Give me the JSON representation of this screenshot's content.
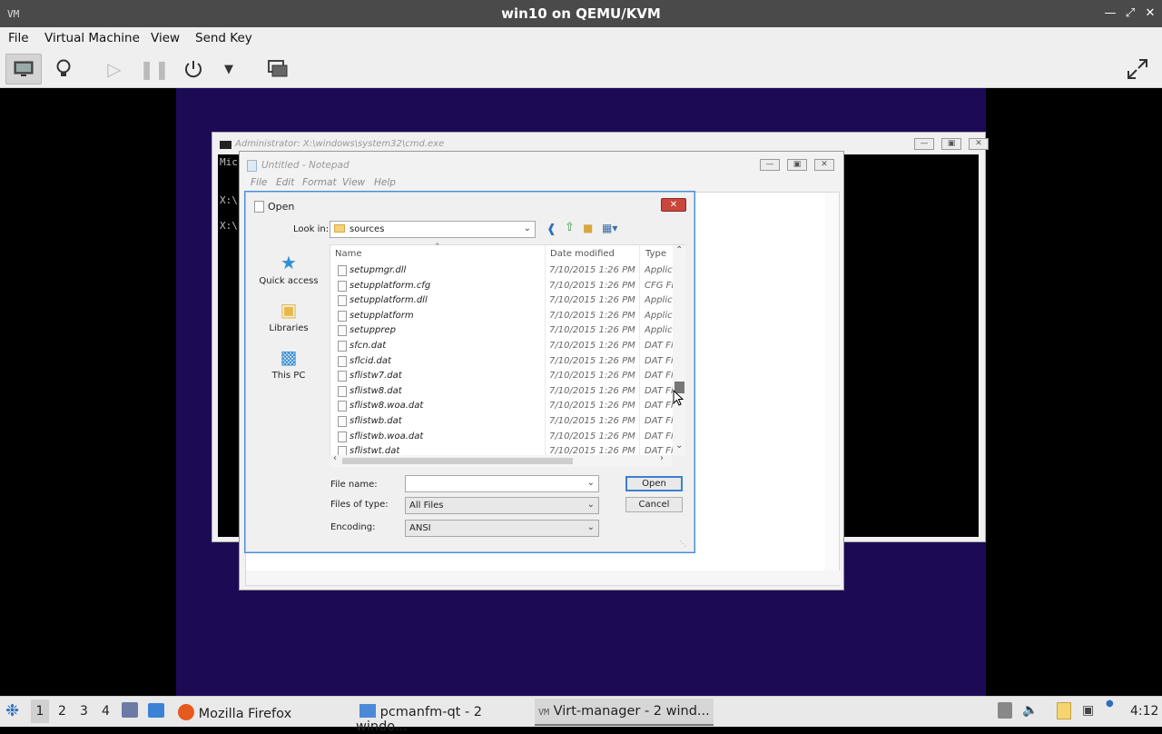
{
  "window": {
    "title": "win10 on QEMU/KVM",
    "app_icon": "VM"
  },
  "menubar": {
    "items": [
      "File",
      "Virtual Machine",
      "View",
      "Send Key"
    ]
  },
  "toolbar": {
    "buttons": [
      "console-icon",
      "details-lightbulb-icon",
      "run-icon",
      "pause-icon",
      "power-icon",
      "power-menu-arrow-icon",
      "snapshots-icon",
      "fullscreen-icon"
    ]
  },
  "guest": {
    "cmd": {
      "title": "Administrator: X:\\windows\\system32\\cmd.exe",
      "lines": [
        "Mic",
        "X:\\",
        "X:\\"
      ]
    },
    "notepad": {
      "title": "Untitled - Notepad",
      "menu": [
        "File",
        "Edit",
        "Format",
        "View",
        "Help"
      ]
    },
    "open_dialog": {
      "title": "Open",
      "look_in_label": "Look in:",
      "look_in_value": "sources",
      "nav": [
        "Quick access",
        "Libraries",
        "This PC"
      ],
      "columns": {
        "name": "Name",
        "date": "Date modified",
        "type": "Type"
      },
      "files": [
        {
          "name": "setupmgr.dll",
          "date": "7/10/2015 1:26 PM",
          "type": "Applicati"
        },
        {
          "name": "setupplatform.cfg",
          "date": "7/10/2015 1:26 PM",
          "type": "CFG File"
        },
        {
          "name": "setupplatform.dll",
          "date": "7/10/2015 1:26 PM",
          "type": "Applicati"
        },
        {
          "name": "setupplatform",
          "date": "7/10/2015 1:26 PM",
          "type": "Applicati"
        },
        {
          "name": "setupprep",
          "date": "7/10/2015 1:26 PM",
          "type": "Applicati"
        },
        {
          "name": "sfcn.dat",
          "date": "7/10/2015 1:26 PM",
          "type": "DAT File"
        },
        {
          "name": "sflcid.dat",
          "date": "7/10/2015 1:26 PM",
          "type": "DAT File"
        },
        {
          "name": "sflistw7.dat",
          "date": "7/10/2015 1:26 PM",
          "type": "DAT File"
        },
        {
          "name": "sflistw8.dat",
          "date": "7/10/2015 1:26 PM",
          "type": "DAT File"
        },
        {
          "name": "sflistw8.woa.dat",
          "date": "7/10/2015 1:26 PM",
          "type": "DAT File"
        },
        {
          "name": "sflistwb.dat",
          "date": "7/10/2015 1:26 PM",
          "type": "DAT File"
        },
        {
          "name": "sflistwb.woa.dat",
          "date": "7/10/2015 1:26 PM",
          "type": "DAT File"
        },
        {
          "name": "sflistwt.dat",
          "date": "7/10/2015 1:26 PM",
          "type": "DAT File"
        }
      ],
      "file_name_label": "File name:",
      "file_name_value": "",
      "files_of_type_label": "Files of type:",
      "files_of_type_value": "All Files",
      "encoding_label": "Encoding:",
      "encoding_value": "ANSI",
      "open_button": "Open",
      "cancel_button": "Cancel"
    }
  },
  "taskbar": {
    "workspaces": [
      "1",
      "2",
      "3",
      "4"
    ],
    "tasks": [
      {
        "label": "Mozilla Firefox"
      },
      {
        "label": "pcmanfm-qt - 2 windo..."
      },
      {
        "label": "Virt-manager - 2 wind..."
      }
    ],
    "clock": "4:12"
  }
}
